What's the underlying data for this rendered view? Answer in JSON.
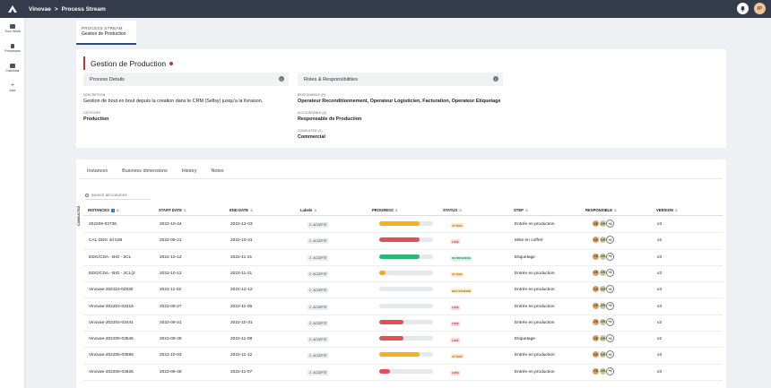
{
  "topbar": {
    "breadcrumb": [
      "Vinovae",
      ">",
      "Process Stream"
    ],
    "avatar_initial": "IP",
    "icons": {
      "logo": "logo-icon",
      "notifications": "bell-icon"
    }
  },
  "sidebar": {
    "items": [
      {
        "label": "Your Work",
        "icon": "briefcase-icon"
      },
      {
        "label": "Processes",
        "icon": "flow-icon"
      },
      {
        "label": "Calendar",
        "icon": "calendar-icon"
      },
      {
        "label": "Add",
        "icon": "plus-icon"
      }
    ]
  },
  "doc_tab": {
    "kicker": "PROCESS STREAM",
    "title": "Gestion de Production"
  },
  "process": {
    "title": "Gestion de Production",
    "details_heading": "Process Details",
    "roles_heading": "Roles & Responsibilities",
    "description_label": "DESCRIPTION",
    "description": "Gestion de bout en bout depuis la creation dans le CRM (Sellsy) jusqu'a la livraison.",
    "category_label": "CATEGORY",
    "category": "Production",
    "responsible_label": "RESPONSIBLE (R)",
    "responsible": "Operateur Reconditionnement, Operateur Logisticien, Facturation, Operateur Etiquetage",
    "accountable_label": "ACCOUNTABLE (A)",
    "accountable": "Responsable de Production",
    "consulted_label": "CONSULTED (C)",
    "consulted": "Commercial"
  },
  "tabs": [
    "Instances",
    "Business dimensions",
    "History",
    "Notes"
  ],
  "search_placeholder": "search all columns",
  "side_label": "CONSULTED",
  "columns": [
    "INSTANCES",
    "START DATE",
    "END DATE",
    "Labels",
    "PROGRESS",
    "STATUS",
    "STEP",
    "RESPONSIBLE",
    "VERSION"
  ],
  "colors": {
    "red": "#e0505a",
    "yellow": "#f5b11a",
    "green": "#2bb673",
    "orange": "#f5a623"
  },
  "rows": [
    {
      "instance": "202206-03736",
      "start": "2022-10-24",
      "end": "2022-12-03",
      "label": "2 - ACCEPTÉ",
      "progress": 0.75,
      "bar_color": "#f5b11a",
      "status": "AT RISK",
      "step": "Entrée en production",
      "resp": [
        "CE",
        "CR",
        "+4"
      ],
      "version": "v3"
    },
    {
      "instance": "CAL DDG 4d 538",
      "start": "2022-09-21",
      "end": "2022-10-31",
      "label": "2 - ACCEPTÉ",
      "progress": 0.75,
      "bar_color": "#e0505a",
      "status": "LATE",
      "step": "Mise en coffret",
      "resp": [
        "CE",
        "CR",
        "+4"
      ],
      "version": "v2"
    },
    {
      "instance": "DDG/CDA - BIO - 2CL",
      "start": "2022-10-12",
      "end": "2022-11-21",
      "label": "2 - ACCEPTÉ",
      "progress": 0.75,
      "bar_color": "#2bb673",
      "status": "IN PROGRESS",
      "step": "Etiquetage",
      "resp": [
        "CE",
        "CR",
        "+4"
      ],
      "version": "v3"
    },
    {
      "instance": "DDG/CDA - BIO - 2CL(2",
      "start": "2022-10-12",
      "end": "2022-11-21",
      "label": "2 - ACCEPTÉ",
      "progress": 0.12,
      "bar_color": "#f5a623",
      "status": "AT RISK",
      "step": "Entrée en production",
      "resp": [
        "CE",
        "CR",
        "+4"
      ],
      "version": "v3"
    },
    {
      "instance": "Vinovae-202110-02930",
      "start": "2022-11-02",
      "end": "2022-12-12",
      "label": "2 - ACCEPTÉ",
      "progress": 0,
      "bar_color": "#e6e8eb",
      "status": "NOT STARTED",
      "step": "Entrée en production",
      "resp": [
        "CE",
        "CR",
        "+4"
      ],
      "version": "v3"
    },
    {
      "instance": "Vinovae-202204-03416",
      "start": "2022-09-27",
      "end": "2022-11-06",
      "label": "2 - ACCEPTÉ",
      "progress": 0,
      "bar_color": "#e6e8eb",
      "status": "LATE",
      "step": "Entrée en production",
      "resp": [
        "CE",
        "CR",
        "+4"
      ],
      "version": "v3"
    },
    {
      "instance": "Vinovae-202204-03441",
      "start": "2022-09-21",
      "end": "2022-10-31",
      "label": "2 - ACCEPTÉ",
      "progress": 0.45,
      "bar_color": "#e0505a",
      "status": "LATE",
      "step": "Entrée en production",
      "resp": [
        "CE",
        "CR",
        "+4"
      ],
      "version": "v3"
    },
    {
      "instance": "Vinovae-202205-03546",
      "start": "2022-09-29",
      "end": "2022-11-08",
      "label": "2 - ACCEPTÉ",
      "progress": 0.45,
      "bar_color": "#e0505a",
      "status": "LATE",
      "step": "Etiquetage",
      "resp": [
        "CE",
        "CR",
        "+4"
      ],
      "version": "v2"
    },
    {
      "instance": "Vinovae-202205-03599",
      "start": "2022-10-03",
      "end": "2022-11-12",
      "label": "2 - ACCEPTÉ",
      "progress": 0.75,
      "bar_color": "#f5b11a",
      "status": "AT RISK",
      "step": "Entrée en production",
      "resp": [
        "CE",
        "CR",
        "+4"
      ],
      "version": "v3"
    },
    {
      "instance": "Vinovae-202206-03626",
      "start": "2022-09-28",
      "end": "2022-11-07",
      "label": "2 - ACCEPTÉ",
      "progress": 0.2,
      "bar_color": "#e0505a",
      "status": "LATE",
      "step": "Entrée en production",
      "resp": [
        "CE",
        "CR",
        "+4"
      ],
      "version": "v3"
    }
  ]
}
